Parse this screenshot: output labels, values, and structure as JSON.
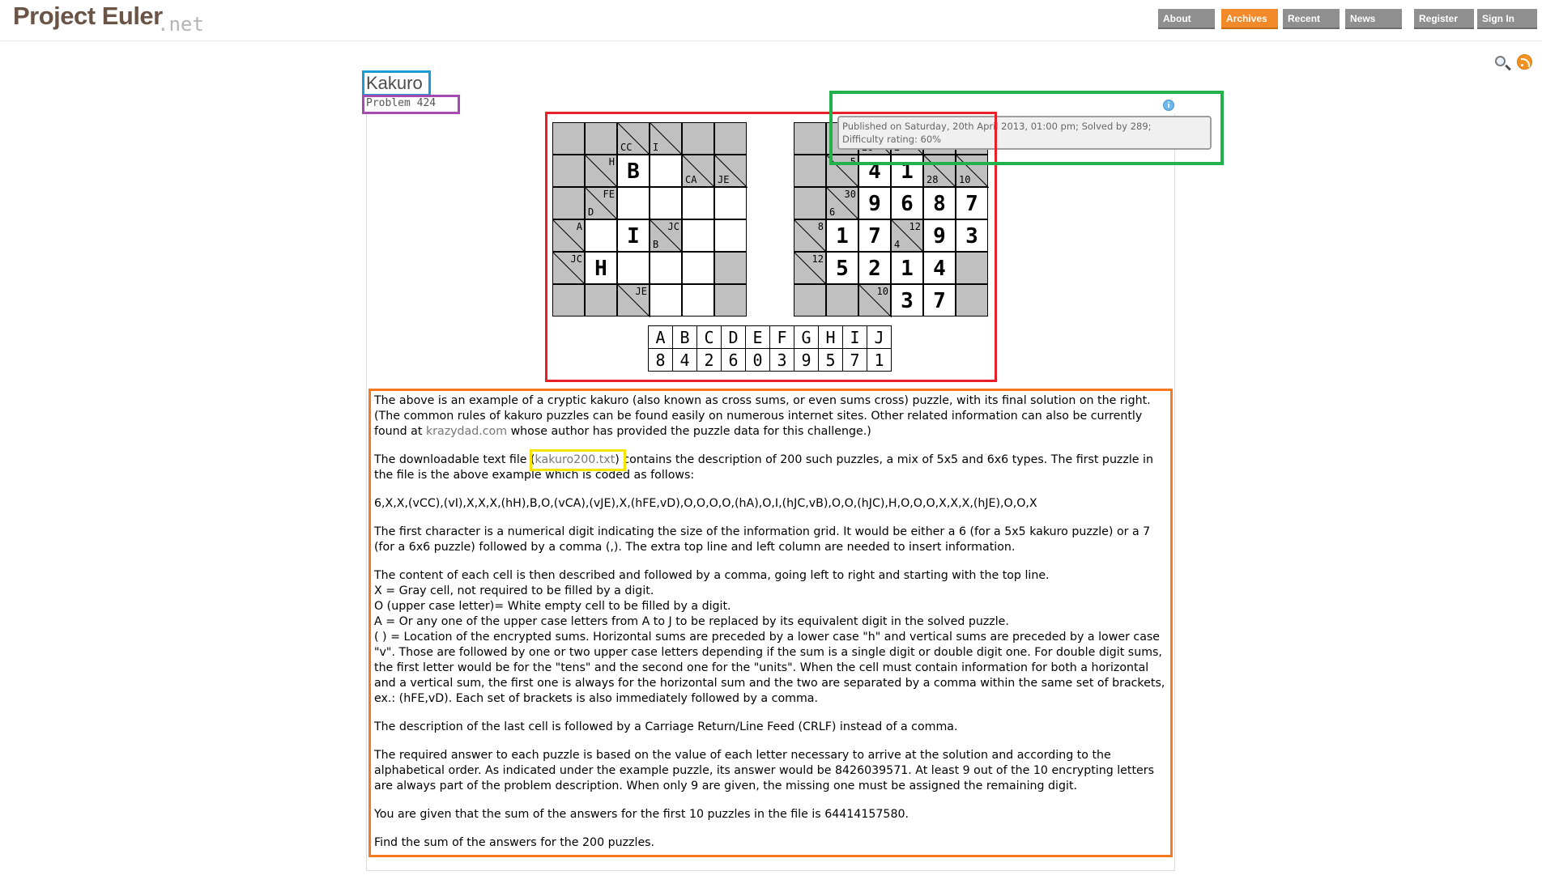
{
  "site": {
    "logo_main": "Project Euler",
    "logo_net": ".net",
    "nav": [
      {
        "label": "About",
        "active": false
      },
      {
        "label": "Archives",
        "active": true
      },
      {
        "label": "Recent",
        "active": false
      },
      {
        "label": "News",
        "active": false
      },
      {
        "label": "Register",
        "active": false
      },
      {
        "label": "Sign In",
        "active": false
      }
    ],
    "icons": [
      "search-icon",
      "rss-icon"
    ]
  },
  "problem": {
    "title": "Kakuro",
    "subtitle": "Problem 424",
    "info_icon": "i",
    "tooltip_line1": "Published on Saturday, 20th April 2013, 01:00 pm; Solved by 289;",
    "tooltip_line2": "Difficulty rating: 60%"
  },
  "puzzle_left": [
    [
      {
        "t": "g"
      },
      {
        "t": "g"
      },
      {
        "t": "d",
        "bl": "CC"
      },
      {
        "t": "d",
        "bl": "I"
      },
      {
        "t": "g"
      },
      {
        "t": "g"
      }
    ],
    [
      {
        "t": "g"
      },
      {
        "t": "d",
        "tr": "H"
      },
      {
        "t": "w",
        "v": "B"
      },
      {
        "t": "w"
      },
      {
        "t": "d",
        "bl": "CA"
      },
      {
        "t": "d",
        "bl": "JE"
      }
    ],
    [
      {
        "t": "g"
      },
      {
        "t": "d",
        "tr": "FE",
        "bl": "D"
      },
      {
        "t": "w"
      },
      {
        "t": "w"
      },
      {
        "t": "w"
      },
      {
        "t": "w"
      }
    ],
    [
      {
        "t": "d",
        "tr": "A"
      },
      {
        "t": "w"
      },
      {
        "t": "w",
        "v": "I"
      },
      {
        "t": "d",
        "tr": "JC",
        "bl": "B"
      },
      {
        "t": "w"
      },
      {
        "t": "w"
      }
    ],
    [
      {
        "t": "d",
        "tr": "JC"
      },
      {
        "t": "w",
        "v": "H"
      },
      {
        "t": "w"
      },
      {
        "t": "w"
      },
      {
        "t": "w"
      },
      {
        "t": "g"
      }
    ],
    [
      {
        "t": "g"
      },
      {
        "t": "g"
      },
      {
        "t": "d",
        "tr": "JE"
      },
      {
        "t": "w"
      },
      {
        "t": "w"
      },
      {
        "t": "g"
      }
    ]
  ],
  "puzzle_right": [
    [
      {
        "t": "g"
      },
      {
        "t": "g"
      },
      {
        "t": "d",
        "bl": "28"
      },
      {
        "t": "d",
        "bl": "2"
      },
      {
        "t": "g"
      },
      {
        "t": "g"
      }
    ],
    [
      {
        "t": "g"
      },
      {
        "t": "d",
        "tr": "5"
      },
      {
        "t": "w",
        "v": "4"
      },
      {
        "t": "w",
        "v": "1"
      },
      {
        "t": "d",
        "bl": "28"
      },
      {
        "t": "d",
        "bl": "10"
      }
    ],
    [
      {
        "t": "g"
      },
      {
        "t": "d",
        "tr": "30",
        "bl": "6"
      },
      {
        "t": "w",
        "v": "9"
      },
      {
        "t": "w",
        "v": "6"
      },
      {
        "t": "w",
        "v": "8"
      },
      {
        "t": "w",
        "v": "7"
      }
    ],
    [
      {
        "t": "d",
        "tr": "8"
      },
      {
        "t": "w",
        "v": "1"
      },
      {
        "t": "w",
        "v": "7"
      },
      {
        "t": "d",
        "tr": "12",
        "bl": "4"
      },
      {
        "t": "w",
        "v": "9"
      },
      {
        "t": "w",
        "v": "3"
      }
    ],
    [
      {
        "t": "d",
        "tr": "12"
      },
      {
        "t": "w",
        "v": "5"
      },
      {
        "t": "w",
        "v": "2"
      },
      {
        "t": "w",
        "v": "1"
      },
      {
        "t": "w",
        "v": "4"
      },
      {
        "t": "g"
      }
    ],
    [
      {
        "t": "g"
      },
      {
        "t": "g"
      },
      {
        "t": "d",
        "tr": "10"
      },
      {
        "t": "w",
        "v": "3"
      },
      {
        "t": "w",
        "v": "7"
      },
      {
        "t": "g"
      }
    ]
  ],
  "key": {
    "letters": [
      "A",
      "B",
      "C",
      "D",
      "E",
      "F",
      "G",
      "H",
      "I",
      "J"
    ],
    "digits": [
      "8",
      "4",
      "2",
      "6",
      "0",
      "3",
      "9",
      "5",
      "7",
      "1"
    ]
  },
  "body": {
    "p1a": "The above is an example of a cryptic kakuro (also known as cross sums, or even sums cross) puzzle, with its final solution on the right. (The common rules of kakuro puzzles can be found easily on numerous internet sites. Other related information can also be currently found at ",
    "p1_link": "krazydad.com",
    "p1b": " whose author has provided the puzzle data for this challenge.)",
    "p2a": "The downloadable text file (",
    "p2_link": "kakuro200.txt",
    "p2b": ") contains the description of 200 such puzzles, a mix of 5x5 and 6x6 types. The first puzzle in the file is the above example which is coded as follows:",
    "p3": "6,X,X,(vCC),(vI),X,X,X,(hH),B,O,(vCA),(vJE),X,(hFE,vD),O,O,O,O,(hA),O,I,(hJC,vB),O,O,(hJC),H,O,O,O,X,X,X,(hJE),O,O,X",
    "p4": "The first character is a numerical digit indicating the size of the information grid. It would be either a 6 (for a 5x5 kakuro puzzle) or a 7 (for a 6x6 puzzle) followed by a comma (,). The extra top line and left column are needed to insert information.",
    "p5_1": "The content of each cell is then described and followed by a comma, going left to right and starting with the top line.",
    "p5_2": "X = Gray cell, not required to be filled by a digit.",
    "p5_3": "O (upper case letter)= White empty cell to be filled by a digit.",
    "p5_4": "A = Or any one of the upper case letters from A to J to be replaced by its equivalent digit in the solved puzzle.",
    "p5_5": "( ) = Location of the encrypted sums. Horizontal sums are preceded by a lower case \"h\" and vertical sums are preceded by a lower case \"v\". Those are followed by one or two upper case letters depending if the sum is a single digit or double digit one. For double digit sums, the first letter would be for the \"tens\" and the second one for the \"units\". When the cell must contain information for both a horizontal and a vertical sum, the first one is always for the horizontal sum and the two are separated by a comma within the same set of brackets, ex.: (hFE,vD). Each set of brackets is also immediately followed by a comma.",
    "p6": "The description of the last cell is followed by a Carriage Return/Line Feed (CRLF) instead of a comma.",
    "p7": "The required answer to each puzzle is based on the value of each letter necessary to arrive at the solution and according to the alphabetical order. As indicated under the example puzzle, its answer would be 8426039571. At least 9 out of the 10 encrypting letters are always part of the problem description. When only 9 are given, the missing one must be assigned the remaining digit.",
    "p8": "You are given that the sum of the answers for the first 10 puzzles in the file is 64414157580.",
    "p9": "Find the sum of the answers for the 200 puzzles."
  },
  "annotation_colors": {
    "title": "#1a9bd7",
    "subtitle": "#a44ab0",
    "puzzle": "#e8202a",
    "tooltip": "#22b24c",
    "text": "#f47b20",
    "link": "#f5e400"
  }
}
